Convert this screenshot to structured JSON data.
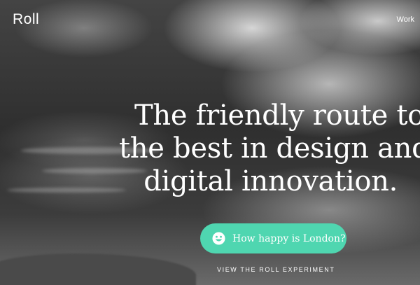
{
  "header": {
    "logo_text": "Roll",
    "nav_work": "Work"
  },
  "hero": {
    "headline_lines": [
      "The friendly route to",
      "the best in design and",
      "digital innovation."
    ],
    "cta_label": "How happy is London?",
    "cta_icon": "smiley-face-icon",
    "experiment_link": "VIEW THE ROLL EXPERIMENT"
  },
  "colors": {
    "accent": "#4fd6b0",
    "text": "#ffffff"
  }
}
